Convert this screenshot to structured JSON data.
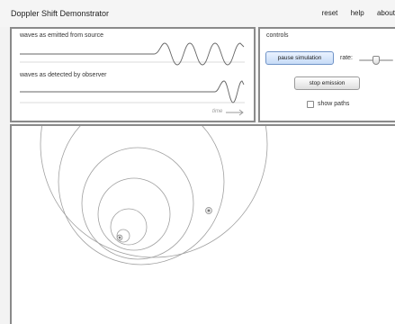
{
  "app": {
    "title": "Doppler Shift Demonstrator"
  },
  "menu": {
    "reset": "reset",
    "help": "help",
    "about": "about"
  },
  "waves": {
    "emitted_label": "waves as emitted from source",
    "detected_label": "waves as detected by observer",
    "time_label": "time"
  },
  "controls": {
    "title": "controls",
    "pause_button": "pause simulation",
    "rate_label": "rate:",
    "stop_button": "stop emission",
    "show_paths_label": "show paths",
    "show_paths_checked": false,
    "rate_value": 0.5
  },
  "colors": {
    "panel_border": "#8a8a8a",
    "wave_line": "#666666",
    "circle_stroke": "#a0a0a0"
  },
  "icons": {
    "time_arrow": "arrow-right-icon",
    "source": "source-dot-icon",
    "observer": "observer-dot-icon"
  }
}
